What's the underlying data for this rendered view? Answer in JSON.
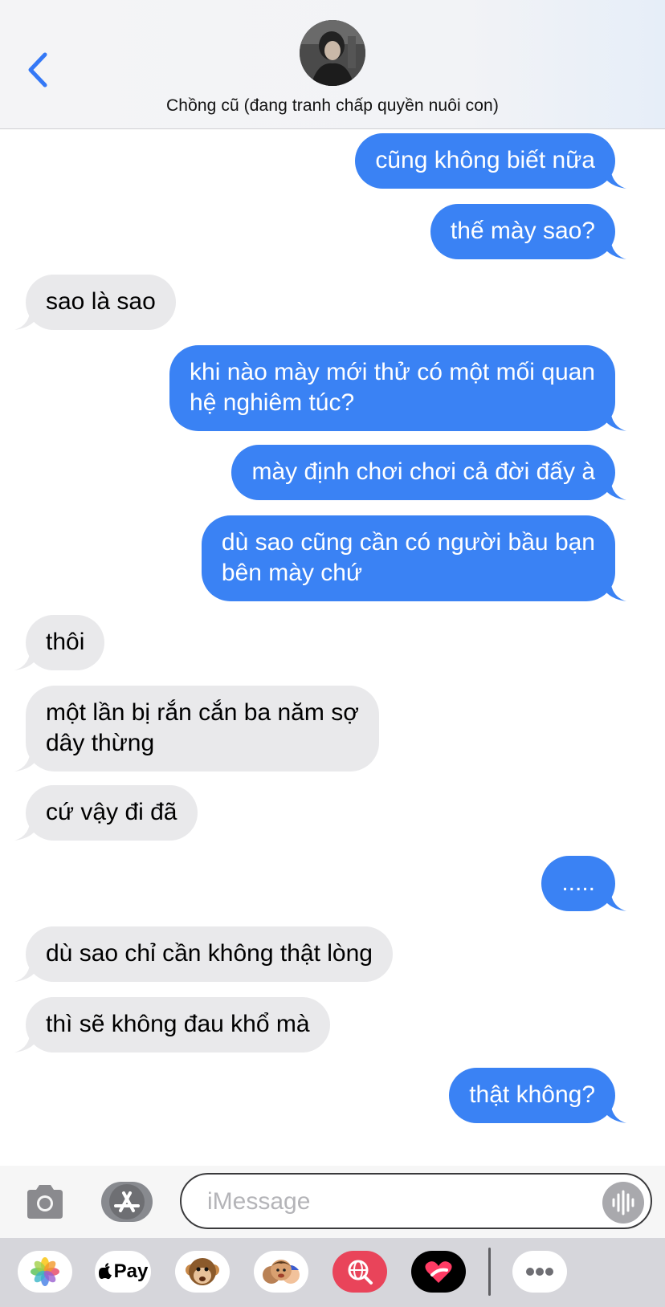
{
  "header": {
    "contact_name": "Chồng cũ (đang tranh chấp quyền nuôi con)"
  },
  "messages": [
    {
      "from": "me",
      "text": "cũng không biết nữa"
    },
    {
      "from": "me",
      "text": "thế mày sao?"
    },
    {
      "from": "them",
      "text": "sao là sao"
    },
    {
      "from": "me",
      "text": "khi nào mày mới thử có một mối quan\nhệ nghiêm túc?"
    },
    {
      "from": "me",
      "text": "mày định chơi chơi cả đời đấy à"
    },
    {
      "from": "me",
      "text": "dù sao cũng cần có người bầu bạn\nbên mày chứ"
    },
    {
      "from": "them",
      "text": "thôi"
    },
    {
      "from": "them",
      "text": "một lần bị rắn cắn ba năm sợ\ndây thừng"
    },
    {
      "from": "them",
      "text": "cứ vậy đi đã"
    },
    {
      "from": "me",
      "text": "....."
    },
    {
      "from": "them",
      "text": "dù sao chỉ cần không thật lòng"
    },
    {
      "from": "them",
      "text": "thì sẽ không đau khổ mà"
    },
    {
      "from": "me",
      "text": "thật không?"
    }
  ],
  "input": {
    "placeholder": "iMessage",
    "value": ""
  },
  "drawer": {
    "apple_pay_label": "Pay",
    "apps": [
      "photos-icon",
      "apple-pay-icon",
      "monkey-animoji-icon",
      "memoji-icon",
      "web-search-icon",
      "digital-touch-icon",
      "more-icon"
    ]
  },
  "colors": {
    "sent_bubble": "#3a82f4",
    "received_bubble": "#e9e9eb",
    "accent": "#3478f6"
  }
}
